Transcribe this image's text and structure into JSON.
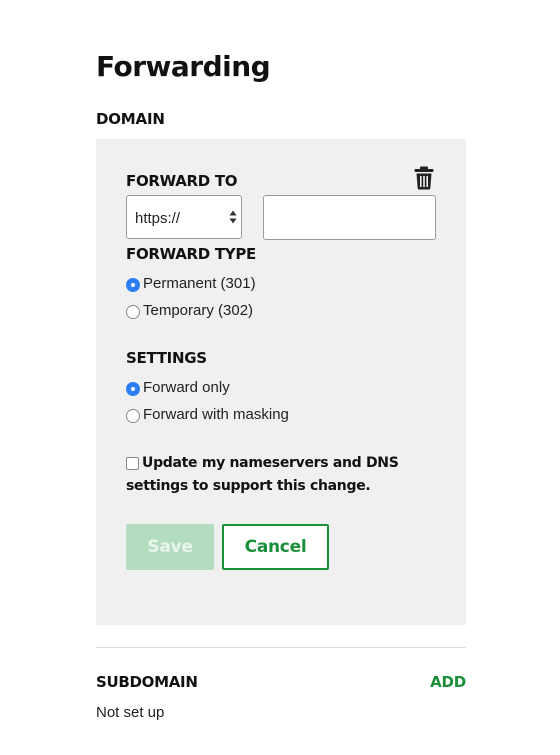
{
  "page": {
    "title": "Forwarding"
  },
  "domain": {
    "section_label": "DOMAIN",
    "forward_to": {
      "label": "FORWARD TO",
      "protocol_selected": "https://",
      "url_value": "",
      "delete_icon": "trash-icon"
    },
    "forward_type": {
      "label": "FORWARD TYPE",
      "options": [
        {
          "label": "Permanent (301)",
          "checked": true
        },
        {
          "label": "Temporary (302)",
          "checked": false
        }
      ]
    },
    "settings": {
      "label": "SETTINGS",
      "options": [
        {
          "label": "Forward only",
          "checked": true
        },
        {
          "label": "Forward with masking",
          "checked": false
        }
      ]
    },
    "update_nameservers": {
      "label": "Update my nameservers and DNS settings to support this change.",
      "checked": false
    },
    "buttons": {
      "save": "Save",
      "cancel": "Cancel"
    }
  },
  "subdomain": {
    "section_label": "SUBDOMAIN",
    "add_label": "ADD",
    "status": "Not set up"
  },
  "colors": {
    "accent_green": "#1c8f3a",
    "save_disabled": "#b4dcc0",
    "radio_blue": "#2a7ff5",
    "panel_bg": "#f0f0f0"
  }
}
